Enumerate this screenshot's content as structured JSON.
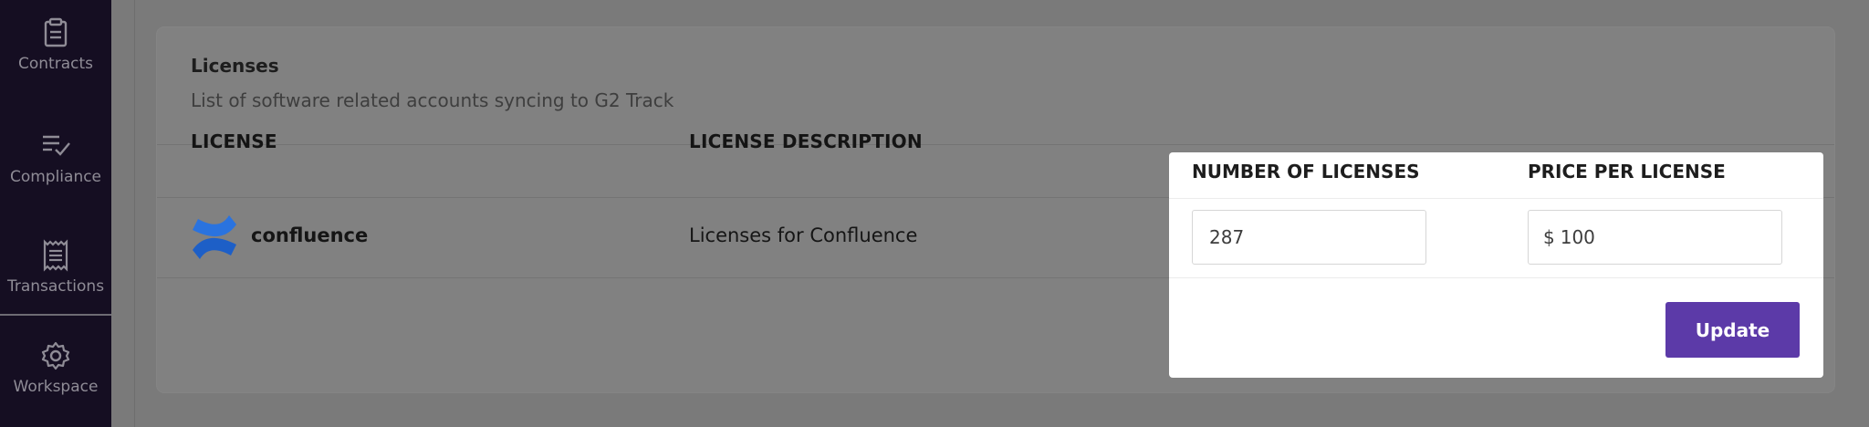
{
  "sidebar": {
    "items": [
      {
        "label": "Contracts",
        "icon": "clipboard-icon"
      },
      {
        "label": "Compliance",
        "icon": "checklist-icon"
      },
      {
        "label": "Transactions",
        "icon": "receipt-icon"
      },
      {
        "label": "Workspace",
        "icon": "gear-icon"
      }
    ]
  },
  "card": {
    "title": "Licenses",
    "subtitle": "List of software related accounts syncing to G2 Track"
  },
  "table": {
    "headers": [
      "LICENSE",
      "LICENSE DESCRIPTION",
      "NUMBER OF LICENSES",
      "PRICE PER LICENSE"
    ],
    "rows": [
      {
        "license": "confluence",
        "logo": "confluence-logo",
        "description": "Licenses for Confluence",
        "number_of_licenses": "287",
        "price_currency": "$",
        "price_per_license": "100"
      }
    ]
  },
  "actions": {
    "update_label": "Update"
  },
  "colors": {
    "sidebar_bg": "#150e22",
    "accent": "#5c3aa8",
    "logo_blue": "#1d5fc7"
  }
}
